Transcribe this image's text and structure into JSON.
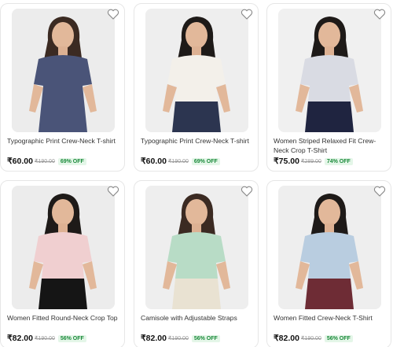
{
  "products": [
    {
      "title": "Typographic Print Crew-Neck T-shirt",
      "price": "₹60.00",
      "mrp": "₹190.00",
      "off": "69% OFF",
      "shirt": "#4a5478",
      "bottom": "#4a5478",
      "bg": "#ececec",
      "hair": "#3b2a22"
    },
    {
      "title": "Typographic Print Crew-Neck T-shirt",
      "price": "₹60.00",
      "mrp": "₹190.00",
      "off": "69% OFF",
      "shirt": "#f3f0ea",
      "bottom": "#2c3550",
      "bg": "#eeeeee",
      "hair": "#1e1a18"
    },
    {
      "title": "Women Striped Relaxed Fit Crew-Neck Crop T-Shirt",
      "price": "₹75.00",
      "mrp": "₹289.00",
      "off": "74% OFF",
      "shirt": "#d9dbe3",
      "bottom": "#1f2440",
      "bg": "#f0f0f0",
      "hair": "#1e1a18"
    },
    {
      "title": "Women Fitted Round-Neck Crop Top",
      "price": "₹82.00",
      "mrp": "₹190.00",
      "off": "56% OFF",
      "shirt": "#f0cfd0",
      "bottom": "#151515",
      "bg": "#ececec",
      "hair": "#1e1a18"
    },
    {
      "title": "Camisole with Adjustable Straps",
      "price": "₹82.00",
      "mrp": "₹190.00",
      "off": "56% OFF",
      "shirt": "#b8dcc6",
      "bottom": "#e9e2d2",
      "bg": "#eeeeee",
      "hair": "#3b2a22"
    },
    {
      "title": "Women Fitted Crew-Neck T-Shirt",
      "price": "₹82.00",
      "mrp": "₹190.00",
      "off": "56% OFF",
      "shirt": "#b9cde0",
      "bottom": "#6e2c35",
      "bg": "#eeeeee",
      "hair": "#1e1a18"
    }
  ],
  "icons": {
    "wishlist": "heart-outline-icon"
  }
}
